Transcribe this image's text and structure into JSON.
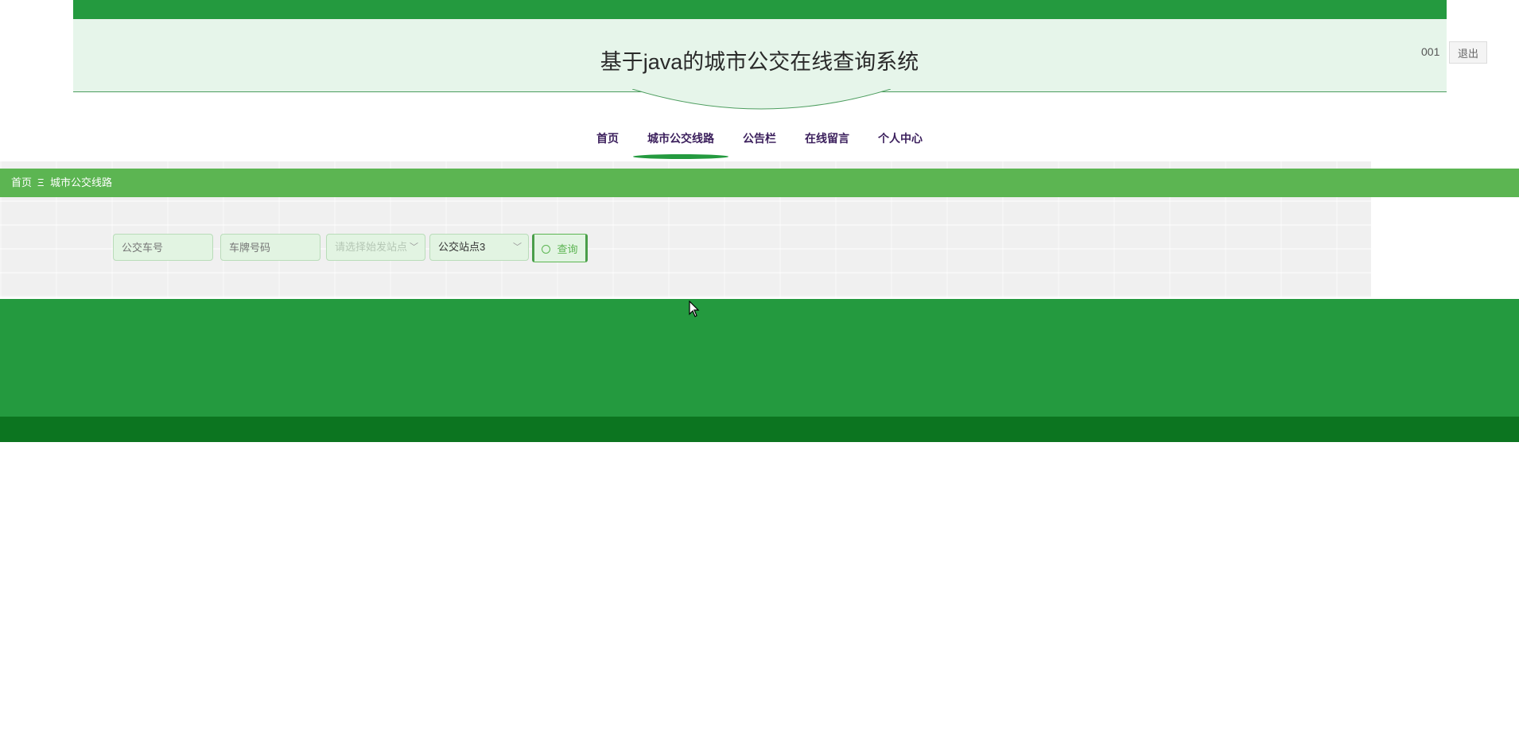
{
  "header": {
    "title": "基于java的城市公交在线查询系统",
    "username": "001",
    "logout_label": "退出"
  },
  "nav": {
    "items": [
      {
        "label": "首页"
      },
      {
        "label": "城市公交线路",
        "active": true
      },
      {
        "label": "公告栏"
      },
      {
        "label": "在线留言"
      },
      {
        "label": "个人中心"
      }
    ]
  },
  "breadcrumb": {
    "home": "首页",
    "separator": "Ξ",
    "current": "城市公交线路"
  },
  "search": {
    "bus_number_placeholder": "公交车号",
    "plate_number_placeholder": "车牌号码",
    "start_station_placeholder": "请选择始发站点",
    "bus_station_value": "公交站点3",
    "query_label": "查询"
  },
  "colors": {
    "primary_green": "#249a3f",
    "breadcrumb_green": "#5cb552",
    "footer_dark_green": "#0c7520",
    "header_bg": "#e6f5ea",
    "nav_text": "#3b1f5c"
  }
}
